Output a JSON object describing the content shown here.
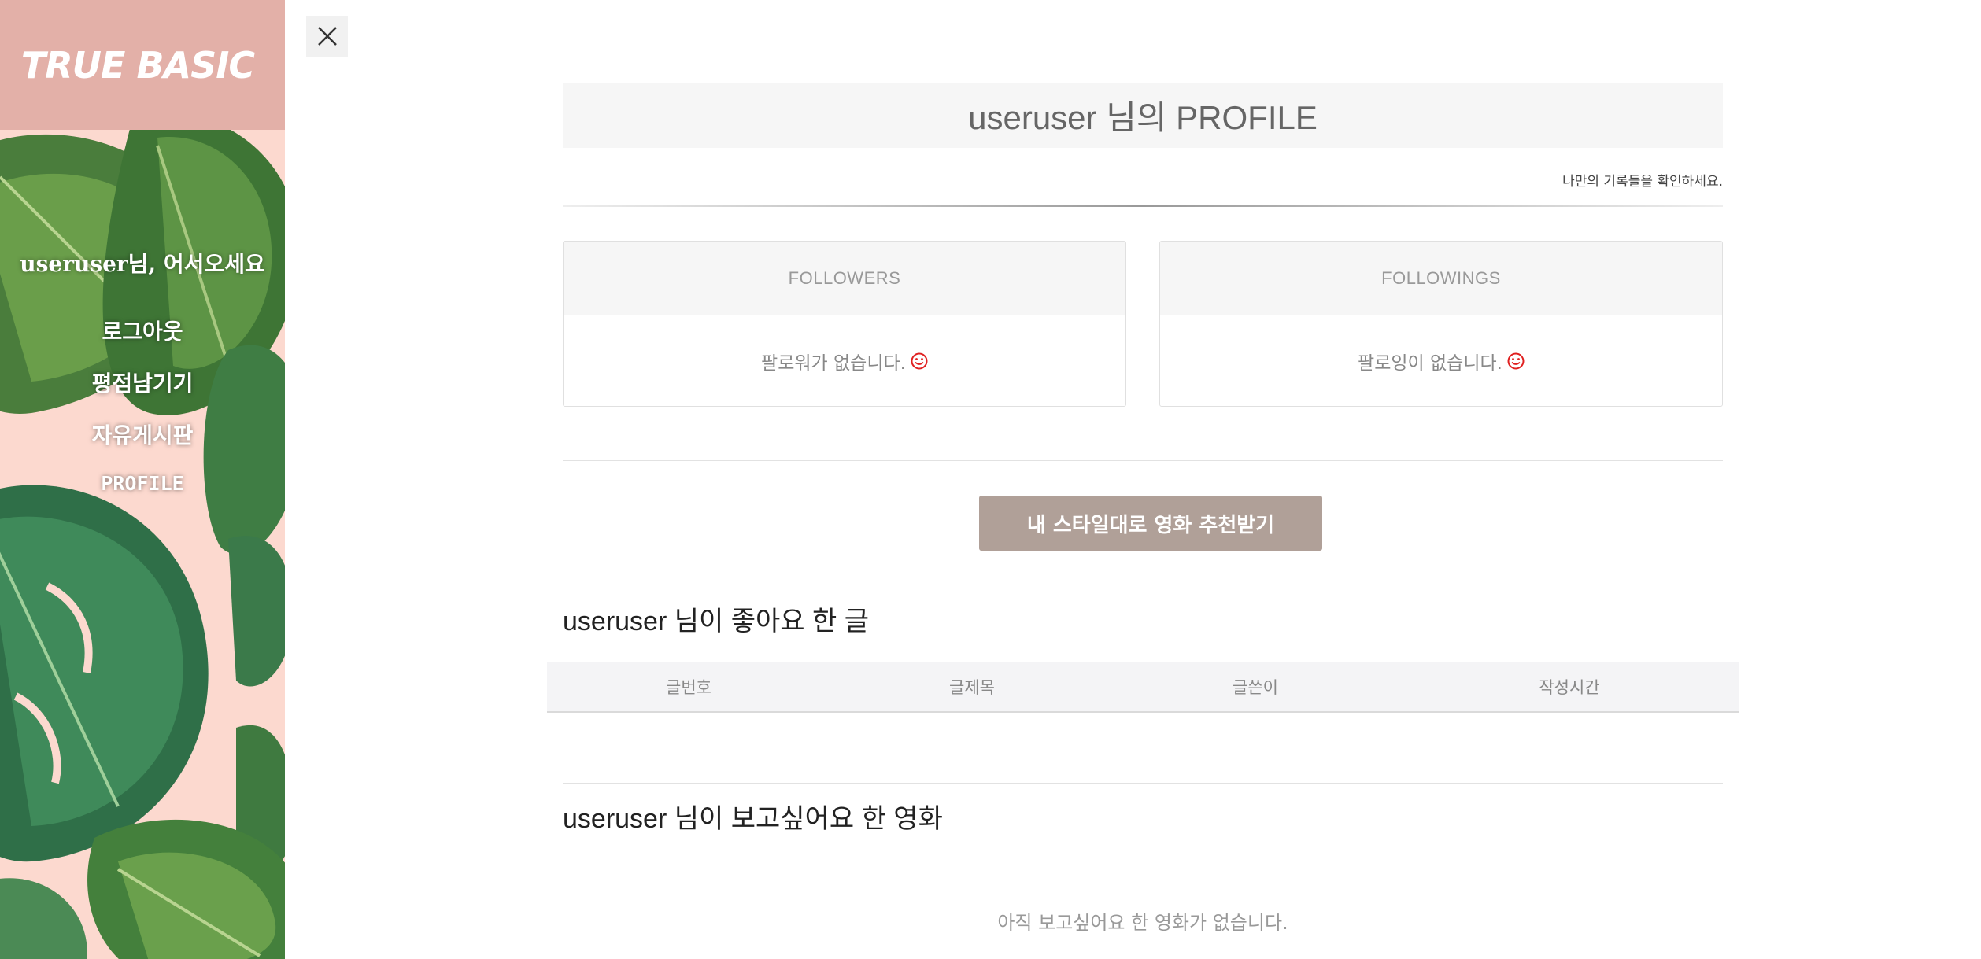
{
  "sidebar": {
    "logo": "TRUE BASIC",
    "greeting": "useruser님, 어서오세요",
    "menu": [
      {
        "label": "로그아웃"
      },
      {
        "label": "평점남기기"
      },
      {
        "label": "자유게시판"
      },
      {
        "label": "PROFILE"
      }
    ]
  },
  "close_icon": "close-icon",
  "main": {
    "title": "useruser 님의 PROFILE",
    "subtitle": "나만의 기록들을 확인하세요.",
    "followers": {
      "header": "FOLLOWERS",
      "empty": "팔로워가 없습니다."
    },
    "followings": {
      "header": "FOLLOWINGS",
      "empty": "팔로잉이 없습니다."
    },
    "recommend_button": "내 스타일대로 영화 추천받기",
    "liked_posts": {
      "title": "useruser 님이 좋아요 한 글",
      "columns": [
        "글번호",
        "글제목",
        "글쓴이",
        "작성시간"
      ],
      "rows": []
    },
    "wishlist": {
      "title": "useruser 님이 보고싶어요 한 영화",
      "empty": "아직 보고싶어요 한 영화가 없습니다."
    }
  },
  "colors": {
    "sidebar_bg": "#fcd9cf",
    "logo_bg": "#e3b0a8",
    "button_bg": "#b0a098",
    "smile_icon": "#e02020"
  }
}
